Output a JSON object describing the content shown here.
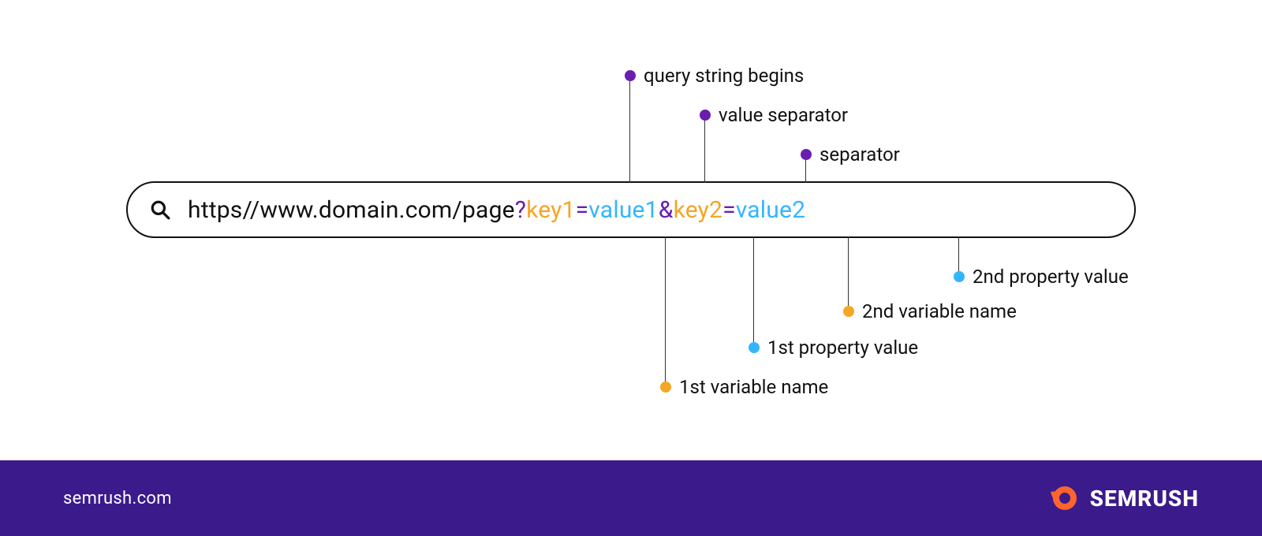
{
  "url": {
    "base": "https//www.domain.com/page",
    "qmark": "?",
    "key1": "key1",
    "eq1": "=",
    "val1": "value1",
    "amp": "&",
    "key2": "key2",
    "eq2": "=",
    "val2": "value2"
  },
  "callouts": {
    "query_begins": "query string begins",
    "value_separator": "value separator",
    "separator": "separator",
    "first_var": "1st variable name",
    "first_val": "1st property value",
    "second_var": "2nd variable name",
    "second_val": "2nd property value"
  },
  "footer": {
    "site": "semrush.com",
    "brand": "SEMRUSH"
  },
  "colors": {
    "purple": "#6a1eb0",
    "orange": "#f5a623",
    "blue": "#33b6ff",
    "footer_bg": "#3b1a8c"
  }
}
